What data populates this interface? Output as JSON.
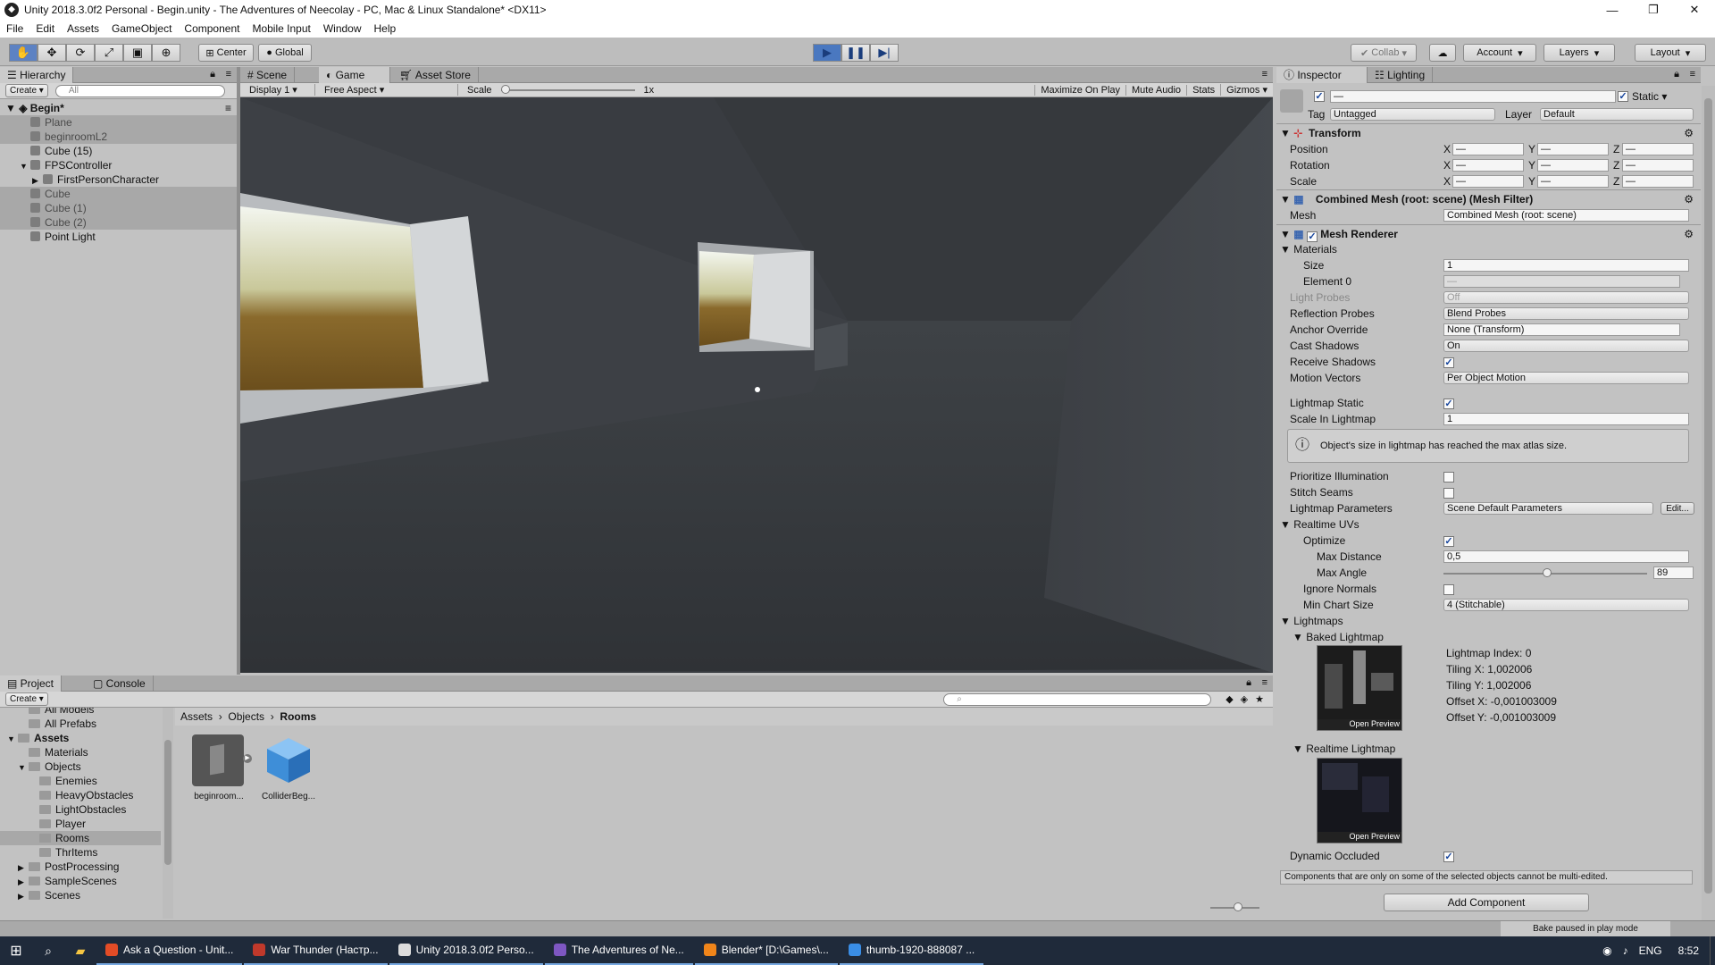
{
  "window": {
    "title": "Unity 2018.3.0f2 Personal - Begin.unity - The Adventures of Neecolay - PC, Mac & Linux Standalone* <DX11>",
    "min": "—",
    "max": "❐",
    "close": "✕"
  },
  "menu": [
    "File",
    "Edit",
    "Assets",
    "GameObject",
    "Component",
    "Mobile Input",
    "Window",
    "Help"
  ],
  "toolbar": {
    "center": "Center",
    "global": "Global",
    "collab": "Collab",
    "account": "Account",
    "layers": "Layers",
    "layout": "Layout"
  },
  "hierarchy": {
    "tab": "Hierarchy",
    "create": "Create",
    "search_placeholder": "All",
    "scene": "Begin*",
    "items": [
      {
        "label": "Plane",
        "indent": 1,
        "selected": true,
        "dim": true,
        "arrow": ""
      },
      {
        "label": "beginroomL2",
        "indent": 1,
        "selected": true,
        "dim": true,
        "arrow": ""
      },
      {
        "label": "Cube (15)",
        "indent": 1,
        "selected": false,
        "dim": false,
        "arrow": ""
      },
      {
        "label": "FPSController",
        "indent": 1,
        "selected": false,
        "dim": false,
        "arrow": "▼"
      },
      {
        "label": "FirstPersonCharacter",
        "indent": 2,
        "selected": false,
        "dim": false,
        "arrow": "▶"
      },
      {
        "label": "Cube",
        "indent": 1,
        "selected": true,
        "dim": true,
        "arrow": ""
      },
      {
        "label": "Cube (1)",
        "indent": 1,
        "selected": true,
        "dim": true,
        "arrow": ""
      },
      {
        "label": "Cube (2)",
        "indent": 1,
        "selected": true,
        "dim": true,
        "arrow": ""
      },
      {
        "label": "Point Light",
        "indent": 1,
        "selected": false,
        "dim": false,
        "arrow": ""
      }
    ]
  },
  "viewtabs": {
    "scene": "Scene",
    "game": "Game",
    "asset_store": "Asset Store"
  },
  "gamebar": {
    "display": "Display 1",
    "aspect": "Free Aspect",
    "scale_label": "Scale",
    "scale_value": "1x",
    "maximize": "Maximize On Play",
    "mute": "Mute Audio",
    "stats": "Stats",
    "gizmos": "Gizmos"
  },
  "inspector": {
    "tab": "Inspector",
    "lighting_tab": "Lighting",
    "name_value": "—",
    "static_label": "Static",
    "tag_label": "Tag",
    "tag_value": "Untagged",
    "layer_label": "Layer",
    "layer_value": "Default",
    "transform": {
      "title": "Transform",
      "rows": [
        "Position",
        "Rotation",
        "Scale"
      ],
      "x": "X",
      "y": "Y",
      "z": "Z",
      "dash": "—"
    },
    "meshfilter": {
      "title": "Combined Mesh (root: scene) (Mesh Filter)",
      "mesh_label": "Mesh",
      "mesh_value": "Combined Mesh (root: scene)"
    },
    "renderer": {
      "title": "Mesh Renderer",
      "materials": "Materials",
      "size_label": "Size",
      "size_value": "1",
      "element0_label": "Element 0",
      "element0_value": "—",
      "light_probes_label": "Light Probes",
      "light_probes_value": "Off",
      "reflection_label": "Reflection Probes",
      "reflection_value": "Blend Probes",
      "anchor_label": "Anchor Override",
      "anchor_value": "None (Transform)",
      "cast_label": "Cast Shadows",
      "cast_value": "On",
      "receive_label": "Receive Shadows",
      "motion_label": "Motion Vectors",
      "motion_value": "Per Object Motion",
      "lm_static_label": "Lightmap Static",
      "scale_lm_label": "Scale In Lightmap",
      "scale_lm_value": "1",
      "warning": "Object's size in lightmap has reached the max atlas size.",
      "prioritize_label": "Prioritize Illumination",
      "stitch_label": "Stitch Seams",
      "lm_params_label": "Lightmap Parameters",
      "lm_params_value": "Scene Default Parameters",
      "edit_btn": "Edit...",
      "realtime_uvs": "Realtime UVs",
      "optimize_label": "Optimize",
      "max_dist_label": "Max Distance",
      "max_dist_value": "0,5",
      "max_angle_label": "Max Angle",
      "max_angle_value": "89",
      "ignore_normals_label": "Ignore Normals",
      "min_chart_label": "Min Chart Size",
      "min_chart_value": "4 (Stitchable)",
      "lightmaps": "Lightmaps",
      "baked": "Baked Lightmap",
      "realtime": "Realtime Lightmap",
      "open_preview": "Open Preview",
      "lm_index": "Lightmap Index: 0",
      "tiling_x": "Tiling X: 1,002006",
      "tiling_y": "Tiling Y: 1,002006",
      "offset_x": "Offset X: -0,001003009",
      "offset_y": "Offset Y: -0,001003009",
      "dynamic_label": "Dynamic Occluded"
    },
    "multi_note": "Components that are only on some of the selected objects cannot be multi-edited.",
    "add_component": "Add Component"
  },
  "project": {
    "tab": "Project",
    "console_tab": "Console",
    "create": "Create",
    "tree": [
      {
        "label": "All Models",
        "indent": 2,
        "arrow": "",
        "selected": false
      },
      {
        "label": "All Prefabs",
        "indent": 2,
        "arrow": "",
        "selected": false
      },
      {
        "label": "Assets",
        "indent": 1,
        "arrow": "▼",
        "selected": false,
        "bold": true
      },
      {
        "label": "Materials",
        "indent": 2,
        "arrow": "",
        "selected": false
      },
      {
        "label": "Objects",
        "indent": 2,
        "arrow": "▼",
        "selected": false
      },
      {
        "label": "Enemies",
        "indent": 3,
        "arrow": "",
        "selected": false
      },
      {
        "label": "HeavyObstacles",
        "indent": 3,
        "arrow": "",
        "selected": false
      },
      {
        "label": "LightObstacles",
        "indent": 3,
        "arrow": "",
        "selected": false
      },
      {
        "label": "Player",
        "indent": 3,
        "arrow": "",
        "selected": false
      },
      {
        "label": "Rooms",
        "indent": 3,
        "arrow": "",
        "selected": true
      },
      {
        "label": "ThrItems",
        "indent": 3,
        "arrow": "",
        "selected": false
      },
      {
        "label": "PostProcessing",
        "indent": 2,
        "arrow": "▶",
        "selected": false
      },
      {
        "label": "SampleScenes",
        "indent": 2,
        "arrow": "▶",
        "selected": false
      },
      {
        "label": "Scenes",
        "indent": 2,
        "arrow": "▶",
        "selected": false
      }
    ],
    "breadcrumb": [
      "Assets",
      "Objects",
      "Rooms"
    ],
    "assets": [
      {
        "label": "beginroom..."
      },
      {
        "label": "ColliderBeg..."
      }
    ]
  },
  "status": {
    "right": "Bake paused in play mode"
  },
  "taskbar": {
    "items": [
      {
        "label": "Ask a Question - Unit...",
        "color": "#e34c26"
      },
      {
        "label": "War Thunder (Настр...",
        "color": "#c0392b"
      },
      {
        "label": "Unity 2018.3.0f2 Perso...",
        "color": "#dddddd"
      },
      {
        "label": "The Adventures of Ne...",
        "color": "#7e57c2"
      },
      {
        "label": "Blender* [D:\\Games\\...",
        "color": "#f0851a"
      },
      {
        "label": "thumb-1920-888087 ...",
        "color": "#3a8ee6"
      }
    ],
    "lang": "ENG",
    "time": "8:52"
  }
}
